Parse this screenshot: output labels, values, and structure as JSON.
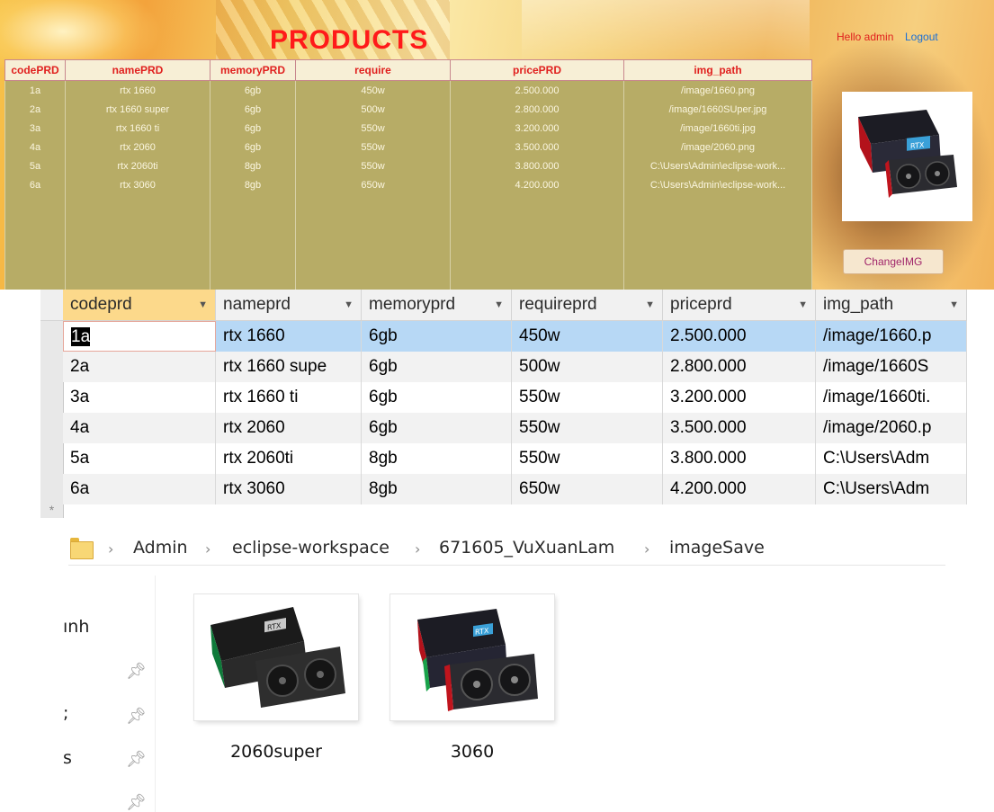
{
  "webapp": {
    "title": "PRODUCTS",
    "hello": "Hello admin",
    "logout": "Logout",
    "change_img": "ChangeIMG",
    "columns": [
      "codePRD",
      "namePRD",
      "memoryPRD",
      "require",
      "pricePRD",
      "img_path"
    ],
    "rows": [
      [
        "1a",
        "rtx 1660",
        "6gb",
        "450w",
        "2.500.000",
        "/image/1660.png"
      ],
      [
        "2a",
        "rtx 1660 super",
        "6gb",
        "500w",
        "2.800.000",
        "/image/1660SUper.jpg"
      ],
      [
        "3a",
        "rtx 1660 ti",
        "6gb",
        "550w",
        "3.200.000",
        "/image/1660ti.jpg"
      ],
      [
        "4a",
        "rtx 2060",
        "6gb",
        "550w",
        "3.500.000",
        "/image/2060.png"
      ],
      [
        "5a",
        "rtx 2060ti",
        "8gb",
        "550w",
        "3.800.000",
        "C:\\Users\\Admin\\eclipse-work..."
      ],
      [
        "6a",
        "rtx 3060",
        "8gb",
        "650w",
        "4.200.000",
        "C:\\Users\\Admin\\eclipse-work..."
      ]
    ]
  },
  "datasheet": {
    "columns": [
      "codeprd",
      "nameprd",
      "memoryprd",
      "requireprd",
      "priceprd",
      "img_path"
    ],
    "rows": [
      [
        "1a",
        "rtx 1660",
        "6gb",
        "450w",
        "2.500.000",
        "/image/1660.p"
      ],
      [
        "2a",
        "rtx 1660 supe",
        "6gb",
        "500w",
        "2.800.000",
        "/image/1660S"
      ],
      [
        "3a",
        "rtx 1660 ti",
        "6gb",
        "550w",
        "3.200.000",
        "/image/1660ti."
      ],
      [
        "4a",
        "rtx 2060",
        "6gb",
        "550w",
        "3.500.000",
        "/image/2060.p"
      ],
      [
        "5a",
        "rtx 2060ti",
        "8gb",
        "550w",
        "3.800.000",
        "C:\\Users\\Adm"
      ],
      [
        "6a",
        "rtx 3060",
        "8gb",
        "650w",
        "4.200.000",
        "C:\\Users\\Adm"
      ]
    ],
    "new_row_marker": "*"
  },
  "explorer": {
    "breadcrumb": [
      "Admin",
      "eclipse-workspace",
      "671605_VuXuanLam",
      "imageSave"
    ],
    "nav_items": [
      "ınh",
      ";",
      "s"
    ],
    "files": [
      {
        "name": "2060super",
        "icon": "gpu-box-image"
      },
      {
        "name": "3060",
        "icon": "gpu-box-image"
      }
    ]
  },
  "colors": {
    "title_red": "#ff1a1a",
    "table_olive": "#b7ac66",
    "selected_row": "#b7d8f5",
    "selected_header": "#fcd98b",
    "folder_yellow": "#f8d775"
  }
}
